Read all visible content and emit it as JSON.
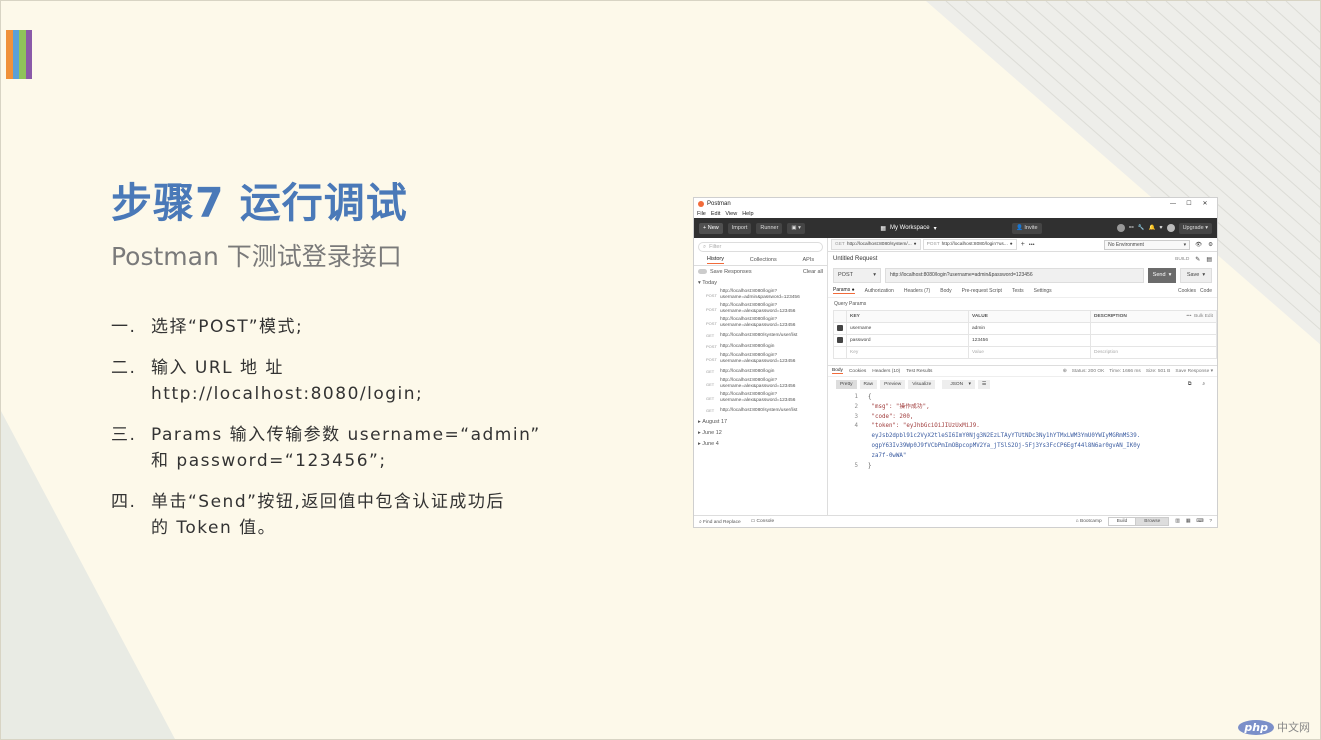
{
  "slide": {
    "title": "步骤7 运行调试",
    "subtitle": "Postman 下测试登录接口",
    "accent_colors": [
      "#f0913a",
      "#5aa0d6",
      "#8fc35a",
      "#8a5aa8"
    ]
  },
  "steps": [
    {
      "num": "一.",
      "lines": [
        "选择“POST”模式;"
      ]
    },
    {
      "num": "二.",
      "lines": [
        "输入 URL 地 址",
        "http://localhost:8080/login;"
      ]
    },
    {
      "num": "三.",
      "lines": [
        "Params 输入传输参数 username=“admin”",
        "和 password=“123456”;"
      ]
    },
    {
      "num": "四.",
      "lines": [
        "单击“Send”按钮,返回值中包含认证成功后",
        "的 Token 值。"
      ]
    }
  ],
  "postman": {
    "window_title": "Postman",
    "window_controls": [
      "—",
      "☐",
      "✕"
    ],
    "menu": [
      "File",
      "Edit",
      "View",
      "Help"
    ],
    "toolbar": {
      "new": "New",
      "import": "Import",
      "runner": "Runner",
      "workspace": "My Workspace",
      "invite": "Invite",
      "upgrade": "Upgrade"
    },
    "sidebar": {
      "filter_placeholder": "Filter",
      "tabs": [
        "History",
        "Collections",
        "APIs"
      ],
      "save_responses": "Save Responses",
      "clear_all": "Clear all",
      "today": "Today",
      "history": [
        {
          "method": "POST",
          "url": "http://localhost:8080/login?username=admin&password=123456"
        },
        {
          "method": "POST",
          "url": "http://localhost:8080/login?username=alex&password=123456"
        },
        {
          "method": "POST",
          "url": "http://localhost:8080/login?username=alex&password=123456"
        },
        {
          "method": "GET",
          "url": "http://localhost:8080/system/user/list"
        },
        {
          "method": "POST",
          "url": "http://localhost:8080/login"
        },
        {
          "method": "POST",
          "url": "http://localhost:8080/login?username=alex&password=123456"
        },
        {
          "method": "GET",
          "url": "http://localhost:8080/login"
        },
        {
          "method": "GET",
          "url": "http://localhost:8080/login?username=alex&password=123456"
        },
        {
          "method": "GET",
          "url": "http://localhost:8080/login?username=alex&password=123456"
        },
        {
          "method": "GET",
          "url": "http://localhost:8080/system/user/list"
        }
      ],
      "groups": [
        "August 17",
        "June 12",
        "June 4"
      ]
    },
    "request_tabs": [
      {
        "method": "GET",
        "label": "http://localhost:8080/system/..."
      },
      {
        "method": "POST",
        "label": "http://localhost:8080/login?us..."
      }
    ],
    "environment": "No Environment",
    "request_name": "Untitled Request",
    "build_label": "BUILD",
    "method": "POST",
    "url": "http://localhost:8080/login?username=admin&password=123456",
    "send": "Send",
    "save": "Save",
    "sub_tabs": [
      "Params ●",
      "Authorization",
      "Headers (7)",
      "Body",
      "Pre-request Script",
      "Tests",
      "Settings"
    ],
    "sub_tabs_right": [
      "Cookies",
      "Code"
    ],
    "query_params_label": "Query Params",
    "table_headers": [
      "KEY",
      "VALUE",
      "DESCRIPTION"
    ],
    "bulk_edit": "Bulk Edit",
    "params": [
      {
        "key": "username",
        "value": "admin"
      },
      {
        "key": "password",
        "value": "123456"
      }
    ],
    "placeholder_row": {
      "key": "Key",
      "value": "Value",
      "description": "Description"
    },
    "response_tabs": [
      "Body",
      "Cookies",
      "Headers (10)",
      "Test Results"
    ],
    "status": {
      "status": "Status: 200 OK",
      "time": "Time: 1666 ms",
      "size": "Size: 501 B",
      "save_response": "Save Response"
    },
    "format_buttons": [
      "Pretty",
      "Raw",
      "Preview",
      "Visualize"
    ],
    "format": "JSON",
    "code_lines": [
      {
        "n": "1",
        "text": "{"
      },
      {
        "n": "2",
        "text": "    \"msg\": \"操作成功\","
      },
      {
        "n": "3",
        "text": "    \"code\": 200,"
      },
      {
        "n": "4",
        "text": "    \"token\": \"eyJhbGciOiJIUzUxMiJ9."
      },
      {
        "n": "",
        "text": "        eyJsb2dpbl91c2VyX2tleSI6ImY0Njg3N2EzLTAyYTUtNDc3Ny1hYTMxLWM3YmU0YWIyMGRmMS39."
      },
      {
        "n": "",
        "text": "        ogpY63Iv39Wp0J9fVCbPmImOBpcopMV2Ya_jTSlS2Oj-5Fj3Ys3FcCP6Egf44l8N6ar0gvAN_IK0y"
      },
      {
        "n": "",
        "text": "        za7f-0wWA\""
      },
      {
        "n": "5",
        "text": "}"
      }
    ],
    "footer": {
      "find_replace": "Find and Replace",
      "console": "Console",
      "bootcamp": "Bootcamp",
      "build": "Build",
      "browse": "Browse"
    }
  },
  "watermark": {
    "logo": "php",
    "text": "中文网"
  }
}
